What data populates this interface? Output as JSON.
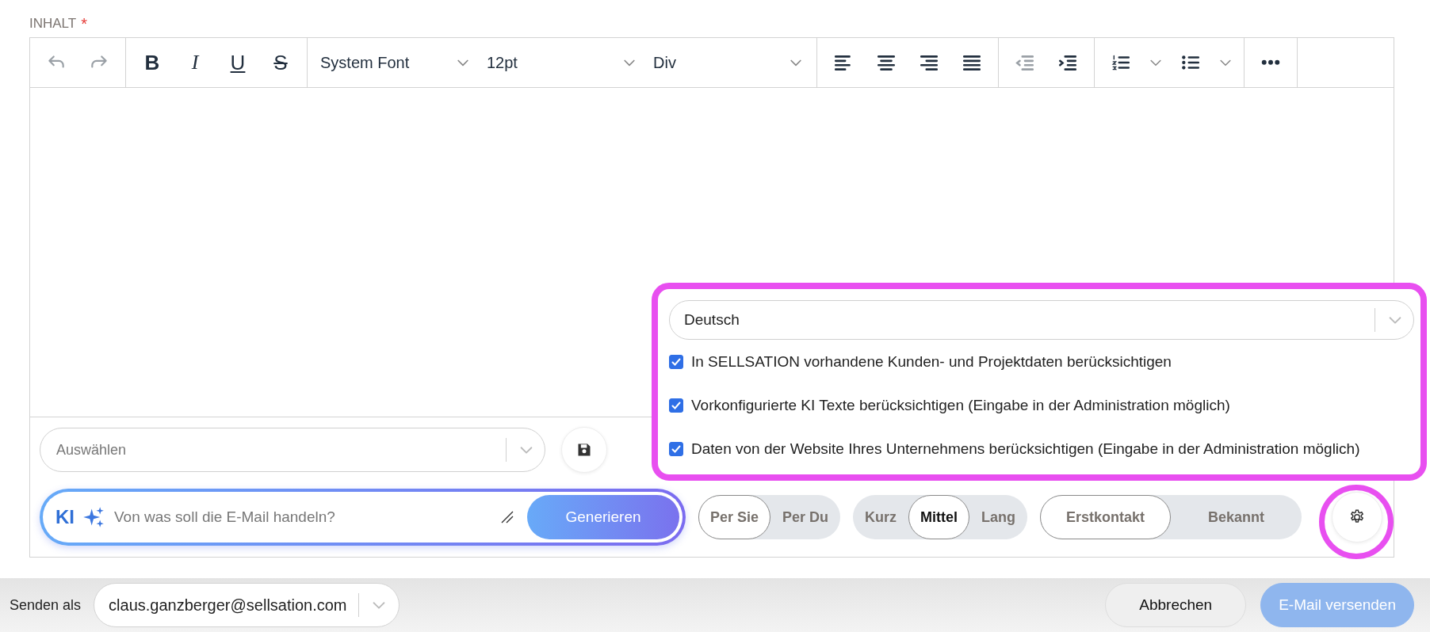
{
  "field": {
    "label": "INHALT",
    "required_mark": "*"
  },
  "toolbar": [
    [
      {
        "kind": "icon",
        "disabled": true
      },
      {
        "kind": "icon",
        "disabled": true
      }
    ],
    [
      {
        "kind": "format",
        "text": "B"
      },
      {
        "kind": "format",
        "text": "I"
      },
      {
        "kind": "format",
        "text": "U"
      },
      {
        "kind": "format",
        "text": "S"
      }
    ],
    [
      {
        "kind": "select",
        "text": "System Font"
      },
      {
        "kind": "select",
        "text": "12pt"
      },
      {
        "kind": "select",
        "text": "Div"
      }
    ],
    [
      {
        "kind": "icon",
        "disabled": false
      },
      {
        "kind": "icon",
        "disabled": false
      },
      {
        "kind": "icon",
        "disabled": false
      },
      {
        "kind": "icon",
        "disabled": false
      }
    ],
    [
      {
        "kind": "icon",
        "disabled": true
      },
      {
        "kind": "icon",
        "disabled": false
      }
    ],
    [
      {
        "kind": "icon",
        "disabled": false
      },
      {
        "kind": "icon",
        "disabled": false
      },
      {
        "kind": "icon",
        "disabled": false
      },
      {
        "kind": "icon",
        "disabled": false
      }
    ],
    [
      {
        "kind": "icon",
        "disabled": false
      }
    ]
  ],
  "template_select": {
    "placeholder": "Auswählen"
  },
  "ai_prompt": {
    "badge": "KI",
    "placeholder": "Von was soll die E-Mail handeln?",
    "button": "Generieren"
  },
  "segments": [
    [
      {
        "label": "Per Sie",
        "selected": true
      },
      {
        "label": "Per Du",
        "selected": false
      }
    ],
    [
      {
        "label": "Kurz",
        "selected": false
      },
      {
        "label": "Mittel",
        "selected": true
      },
      {
        "label": "Lang",
        "selected": false
      }
    ],
    [
      {
        "label": "Erstkontakt",
        "selected": true
      },
      {
        "label": "Bekannt",
        "selected": false
      }
    ]
  ],
  "settings_popup": {
    "language": "Deutsch",
    "options": [
      {
        "label": "In SELLSATION vorhandene Kunden- und Projektdaten berücksichtigen",
        "checked": true
      },
      {
        "label": "Vorkonfigurierte KI Texte berücksichtigen (Eingabe in der Administration möglich)",
        "checked": true
      },
      {
        "label": "Daten von der Website Ihres Unternehmens berücksichtigen (Eingabe in der Administration möglich)",
        "checked": true
      }
    ]
  },
  "footer": {
    "sender_label": "Senden als",
    "sender": "claus.ganzberger@sellsation.com",
    "buttons": [
      {
        "label": "Abbrechen",
        "disabled": false
      },
      {
        "label": "E-Mail versenden",
        "disabled": true
      }
    ]
  }
}
